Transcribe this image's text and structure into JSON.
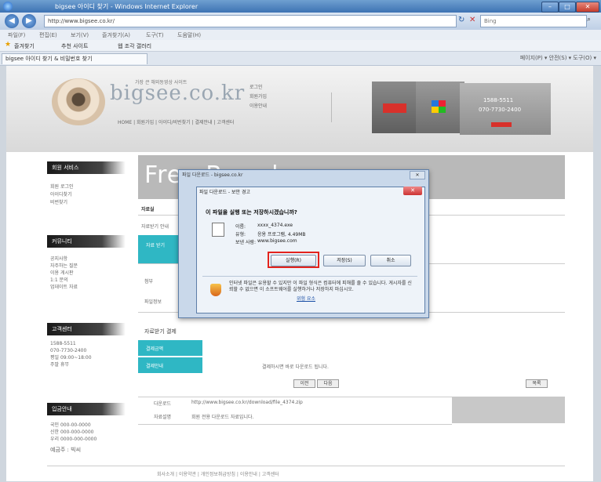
{
  "browser": {
    "window_title": "bigsee 아이디 찾기 - Windows Internet Explorer",
    "address": "http://www.bigsee.co.kr/",
    "search_placeholder": "Bing",
    "menu": [
      "파일(F)",
      "편집(E)",
      "보기(V)",
      "즐겨찾기(A)",
      "도구(T)",
      "도움말(H)"
    ],
    "favorites_label": "즐겨찾기",
    "fav_links": [
      "추천 사이트",
      "웹 조각 갤러리"
    ],
    "tab_label": "bigsee 아이디 찾기 & 비밀번호 찾기",
    "cmdbar": "페이지(P) ▾  안전(S) ▾  도구(O) ▾"
  },
  "site": {
    "logo_text": "bigsee.co.kr",
    "logo_tagline": "가장 큰 해외동영상 사이트",
    "header_nav": "HOME | 회원가입 | 아이디/비번찾기 | 결제안내 | 고객센터",
    "header_links": [
      "로그인",
      "회원가입",
      "이용안내"
    ],
    "promo3_phone1": "1588-5511",
    "promo3_phone2": "070-7730-2400"
  },
  "sidebar": {
    "sections": [
      {
        "heading": "회원 서비스",
        "items": [
          "회원 로그인",
          "아이디찾기",
          "비번찾기"
        ]
      },
      {
        "heading": "커뮤니티",
        "items": [
          "공지사항",
          "자주하는 질문",
          "이용 게시판",
          "1:1 문의",
          "업데이트 자료"
        ]
      },
      {
        "heading": "고객센터",
        "items": [
          "1588-5511",
          "070-7730-2400",
          "평일 09:00~18:00",
          "주말 휴무"
        ]
      },
      {
        "heading": "입금안내",
        "items": [
          "국민 000-00-0000",
          "신한 000-000-0000",
          "우리 0000-000-0000",
          "예금주 : 빅씨"
        ]
      }
    ]
  },
  "main": {
    "banner_title": "Free Board",
    "breadcrumb": "자료실",
    "sub_heading": "자료받기 안내",
    "tab_label": "자료 받기",
    "row_labels": [
      "첨부",
      "파일정보"
    ],
    "section_heading": "자료받기 결제",
    "pay_labels": [
      "결제금액",
      "결제안내"
    ],
    "pay_note": "결제하시면 바로 다운로드 됩니다.",
    "btn_prev": "이전",
    "btn_next": "다음",
    "btn_list": "목록",
    "info_rows": [
      {
        "label": "다운로드",
        "value": "http://www.bigsee.co.kr/download/file_4374.zip"
      },
      {
        "label": "자료설명",
        "value": "회원 전용 다운로드 자료입니다."
      }
    ]
  },
  "footer": "회사소개 | 이용약관 | 개인정보취급방침 | 이용안내 | 고객센터",
  "dialog": {
    "outer_title": "파일 다운로드 - bigsee.co.kr",
    "title": "파일 다운로드 - 보안 경고",
    "question": "이 파일을 실행 또는 저장하시겠습니까?",
    "name_label": "이름:",
    "name_value": "xxxx_4374.exe",
    "type_label": "유형:",
    "type_value": "응용 프로그램, 4.49MB",
    "from_label": "보낸 사람:",
    "from_value": "www.bigsee.com",
    "btn_run": "실행(R)",
    "btn_save": "저장(S)",
    "btn_cancel": "취소",
    "warning": "인터넷 파일은 유용할 수 있지만 이 파일 형식은 컴퓨터에 피해를 줄 수 있습니다. 게시자를 신뢰할 수 없으면 이 소프트웨어를 실행하거나 저장하지 마십시오.",
    "warning_link": "위험 요소",
    "accent_color": "#e3231d"
  },
  "colors": {
    "teal": "#2fb7c4",
    "title_bar": "#3d73b3"
  }
}
